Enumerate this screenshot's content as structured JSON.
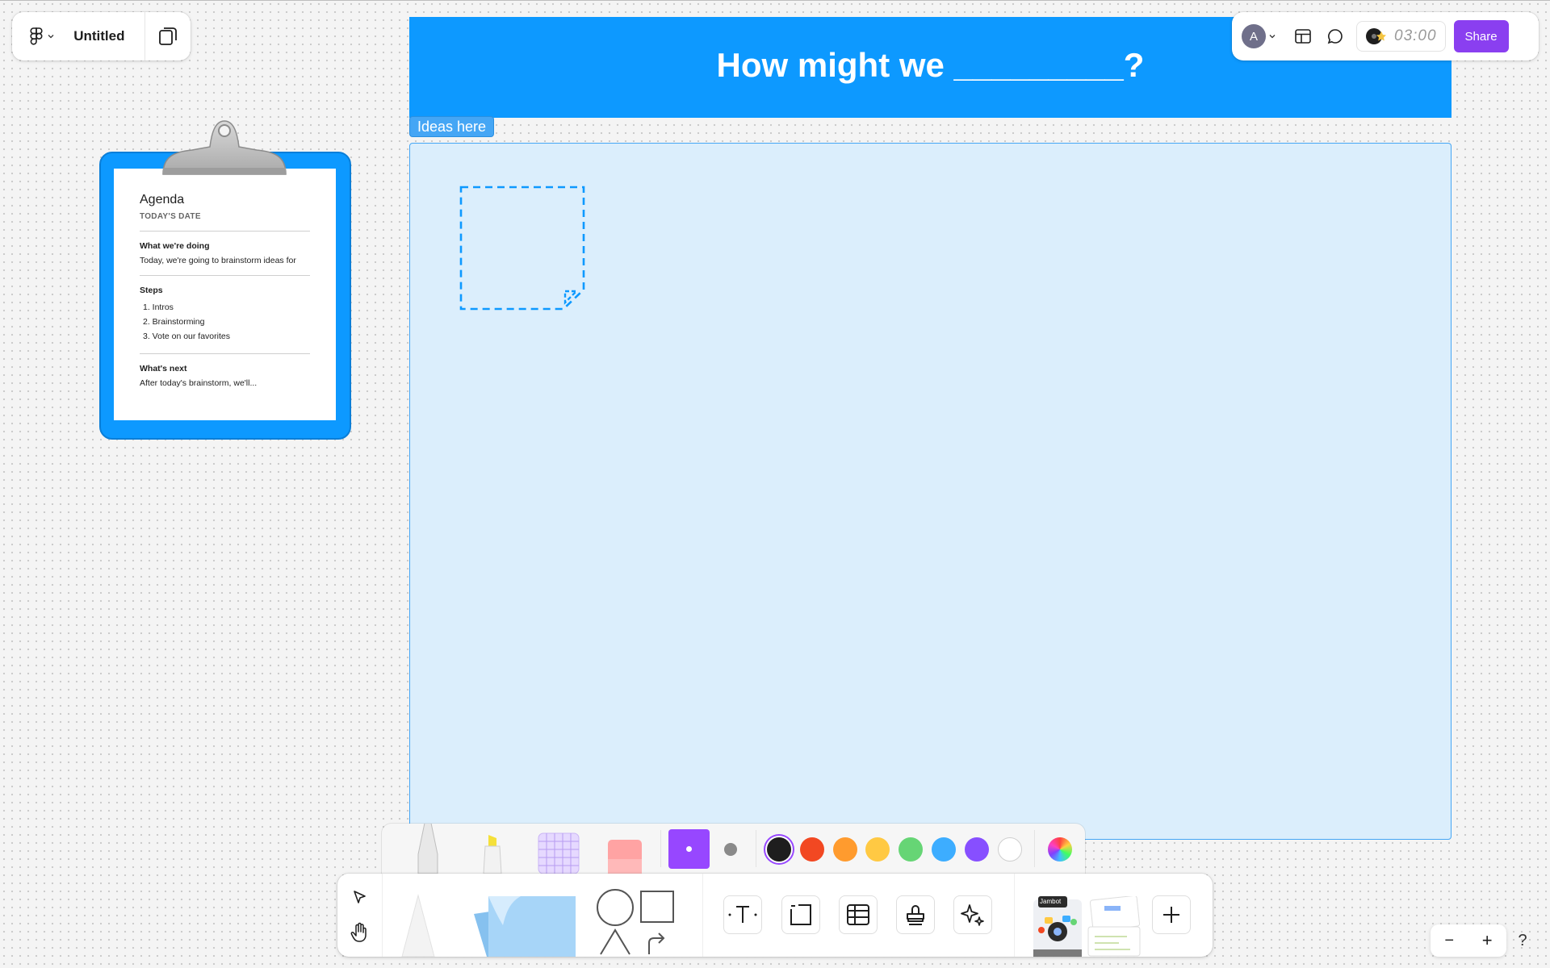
{
  "header": {
    "file_title": "Untitled",
    "share_label": "Share",
    "avatar_initial": "A",
    "timer": "03:00"
  },
  "board": {
    "hmw_title": "How might we _________?",
    "section_label": "Ideas here"
  },
  "agenda": {
    "title": "Agenda",
    "date": "TODAY'S DATE",
    "doing_heading": "What we're doing",
    "doing_text": "Today, we're going to brainstorm ideas for",
    "steps_heading": "Steps",
    "steps": [
      "1. Intros",
      "2. Brainstorming",
      "3. Vote on our favorites"
    ],
    "next_heading": "What's next",
    "next_text": "After today's brainstorm, we'll..."
  },
  "palette": {
    "colors": [
      "#1e1e1e",
      "#f24822",
      "#ff9b2e",
      "#ffc943",
      "#66d575",
      "#3dadff",
      "#874fff",
      "#ffffff"
    ],
    "selected": "#1e1e1e",
    "accent": "#9747ff"
  },
  "toolbar": {
    "templates_badge": "Jambot"
  },
  "zoom": {
    "minus": "−",
    "plus": "+",
    "help": "?"
  }
}
